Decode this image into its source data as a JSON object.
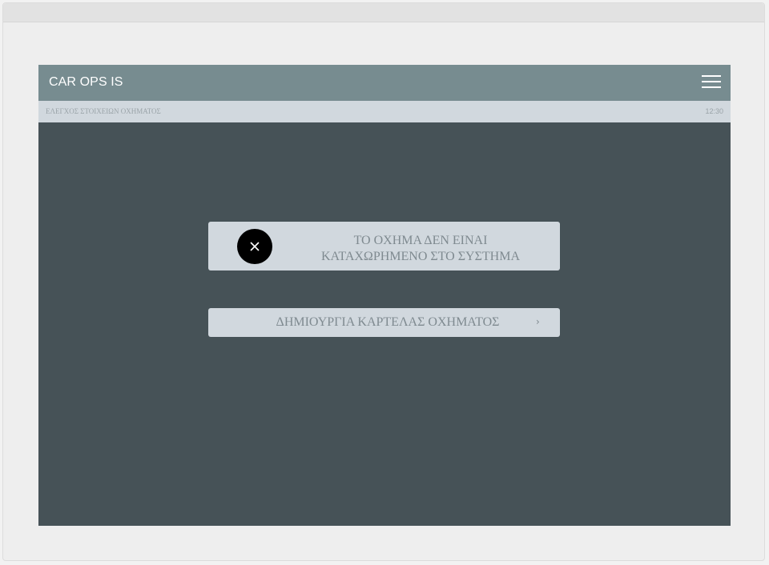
{
  "app": {
    "title": "CAR OPS IS",
    "menu_icon": "hamburger-menu-icon"
  },
  "subheader": {
    "title": "ΕΛΕΓΧΟΣ ΣΤΟΙΧΕΙΩΝ ΟΧΗΜΑΤΟΣ",
    "time": "12:30"
  },
  "message": {
    "icon": "close-icon",
    "line1": "ΤΟ ΟΧΗΜΑ ΔΕΝ ΕΙΝΑΙ",
    "line2": "ΚΑΤΑΧΩΡΗΜΕΝΟ ΣΤΟ ΣΥΣΤΗΜΑ"
  },
  "action": {
    "label": "ΔΗΜΙΟΥΡΓΙΑ ΚΑΡΤΕΛΑΣ ΟΧΗΜΑΤΟΣ",
    "chevron": "›"
  },
  "colors": {
    "header": "#778c90",
    "subheader": "#d1d8de",
    "body": "#465257",
    "panel": "#d1d8de",
    "text": "#7f8a90"
  }
}
